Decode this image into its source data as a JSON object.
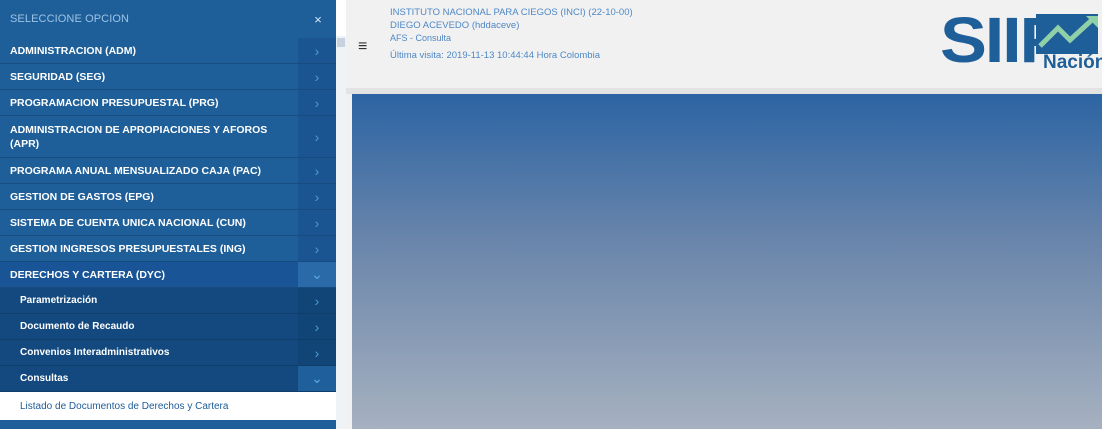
{
  "sidebar": {
    "title": "SELECCIONE OPCION",
    "close_symbol": "×",
    "items": [
      {
        "label": "ADMINISTRACION (ADM)"
      },
      {
        "label": "SEGURIDAD (SEG)"
      },
      {
        "label": "PROGRAMACION PRESUPUESTAL (PRG)"
      },
      {
        "label": "ADMINISTRACION DE APROPIACIONES Y AFOROS (APR)"
      },
      {
        "label": "PROGRAMA ANUAL MENSUALIZADO CAJA (PAC)"
      },
      {
        "label": "GESTION DE GASTOS (EPG)"
      },
      {
        "label": "SISTEMA DE CUENTA UNICA NACIONAL (CUN)"
      },
      {
        "label": "GESTION INGRESOS PRESUPUESTALES (ING)"
      },
      {
        "label": "DERECHOS Y CARTERA (DYC)"
      }
    ],
    "subitems": [
      {
        "label": "Parametrización"
      },
      {
        "label": "Documento de Recaudo"
      },
      {
        "label": "Convenios Interadministrativos"
      },
      {
        "label": "Consultas"
      }
    ],
    "leaf": "Listado de Documentos de Derechos y Cartera",
    "arrow_right": "›",
    "arrow_down": "⌄"
  },
  "header": {
    "hamburger": "≡",
    "entity": "INSTITUTO NACIONAL PARA CIEGOS (INCI) (22-10-00)",
    "user": "DIEGO ACEVEDO (hddaceve)",
    "role": "AFS - Consulta",
    "last_visit": "Última visita: 2019-11-13 10:44:44 Hora Colombia"
  },
  "logo": {
    "text": "SIIF",
    "subtext": "Nación"
  },
  "colors": {
    "sidebar": "#1f5f99",
    "accent": "#4e88c6",
    "leaf_text": "#1d5b98"
  }
}
